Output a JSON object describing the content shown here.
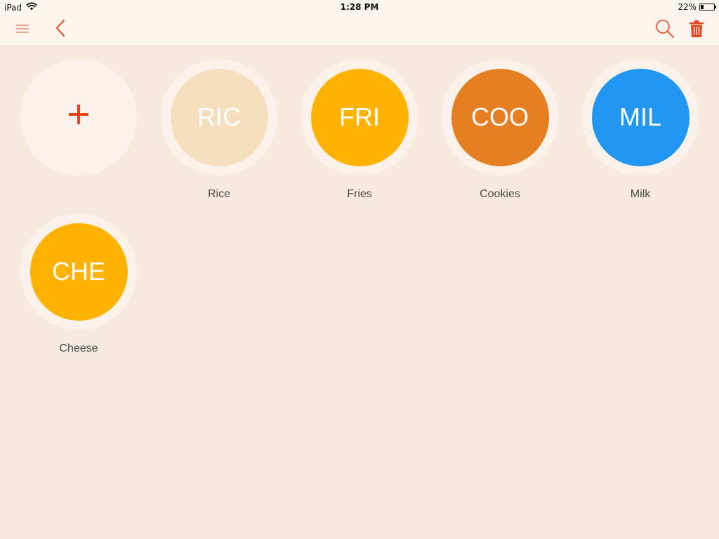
{
  "status_bar": {
    "device": "iPad",
    "time": "1:28 PM",
    "battery_percent": "22%",
    "battery_level": 0.22
  },
  "toolbar": {
    "menu_icon": "hamburger-icon",
    "back_icon": "chevron-left-icon",
    "search_icon": "search-icon",
    "delete_icon": "trash-icon",
    "accent_color": "#e8421f"
  },
  "items": [
    {
      "abbr": "",
      "label": "",
      "color": "",
      "type": "add",
      "icon": "plus-icon"
    },
    {
      "abbr": "RIC",
      "label": "Rice",
      "color": "#f5dfbf"
    },
    {
      "abbr": "FRI",
      "label": "Fries",
      "color": "#ffb300"
    },
    {
      "abbr": "COO",
      "label": "Cookies",
      "color": "#e67e22"
    },
    {
      "abbr": "MIL",
      "label": "Milk",
      "color": "#2196f3"
    },
    {
      "abbr": "CHE",
      "label": "Cheese",
      "color": "#ffb300"
    }
  ]
}
